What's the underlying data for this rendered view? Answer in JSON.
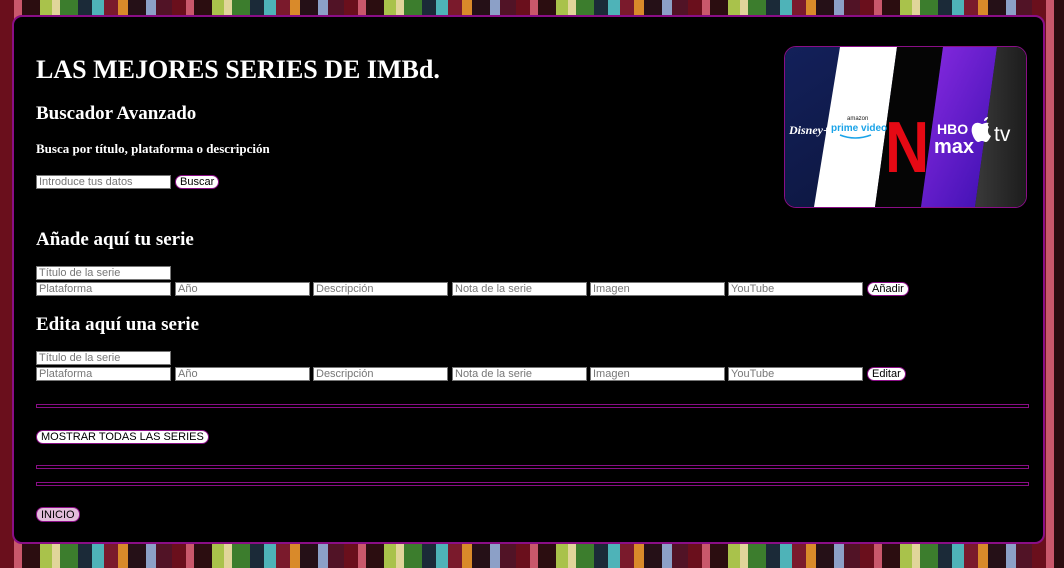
{
  "header": {
    "title": "LAS MEJORES SERIES DE IMBd."
  },
  "search": {
    "heading": "Buscador Avanzado",
    "subtitle": "Busca por título, plataforma o descripción",
    "placeholder": "Introduce tus datos",
    "button_label": "Buscar"
  },
  "add_form": {
    "heading": "Añade aquí tu serie",
    "title_placeholder": "Título de la serie",
    "platform_placeholder": "Plataforma",
    "year_placeholder": "Año",
    "description_placeholder": "Descripción",
    "rating_placeholder": "Nota de la serie",
    "image_placeholder": "Imagen",
    "youtube_placeholder": "YouTube",
    "button_label": "Añadir"
  },
  "edit_form": {
    "heading": "Edita aquí una serie",
    "title_placeholder": "Título de la serie",
    "platform_placeholder": "Plataforma",
    "year_placeholder": "Año",
    "description_placeholder": "Descripción",
    "rating_placeholder": "Nota de la serie",
    "image_placeholder": "Imagen",
    "youtube_placeholder": "YouTube",
    "button_label": "Editar"
  },
  "show_all": {
    "button_label": "MOSTRAR TODAS LAS SERIES"
  },
  "home": {
    "button_label": "INICIO"
  },
  "banner": {
    "disney_label": "Disney+",
    "amazon_label": "amazon",
    "prime_label": "prime video",
    "netflix_label": "N",
    "hbo_label": "HBO",
    "max_label": "max",
    "appletv_label": "tv"
  },
  "colors": {
    "accent": "#8a0e86",
    "panel_bg": "#000000",
    "text": "#ffffff"
  }
}
